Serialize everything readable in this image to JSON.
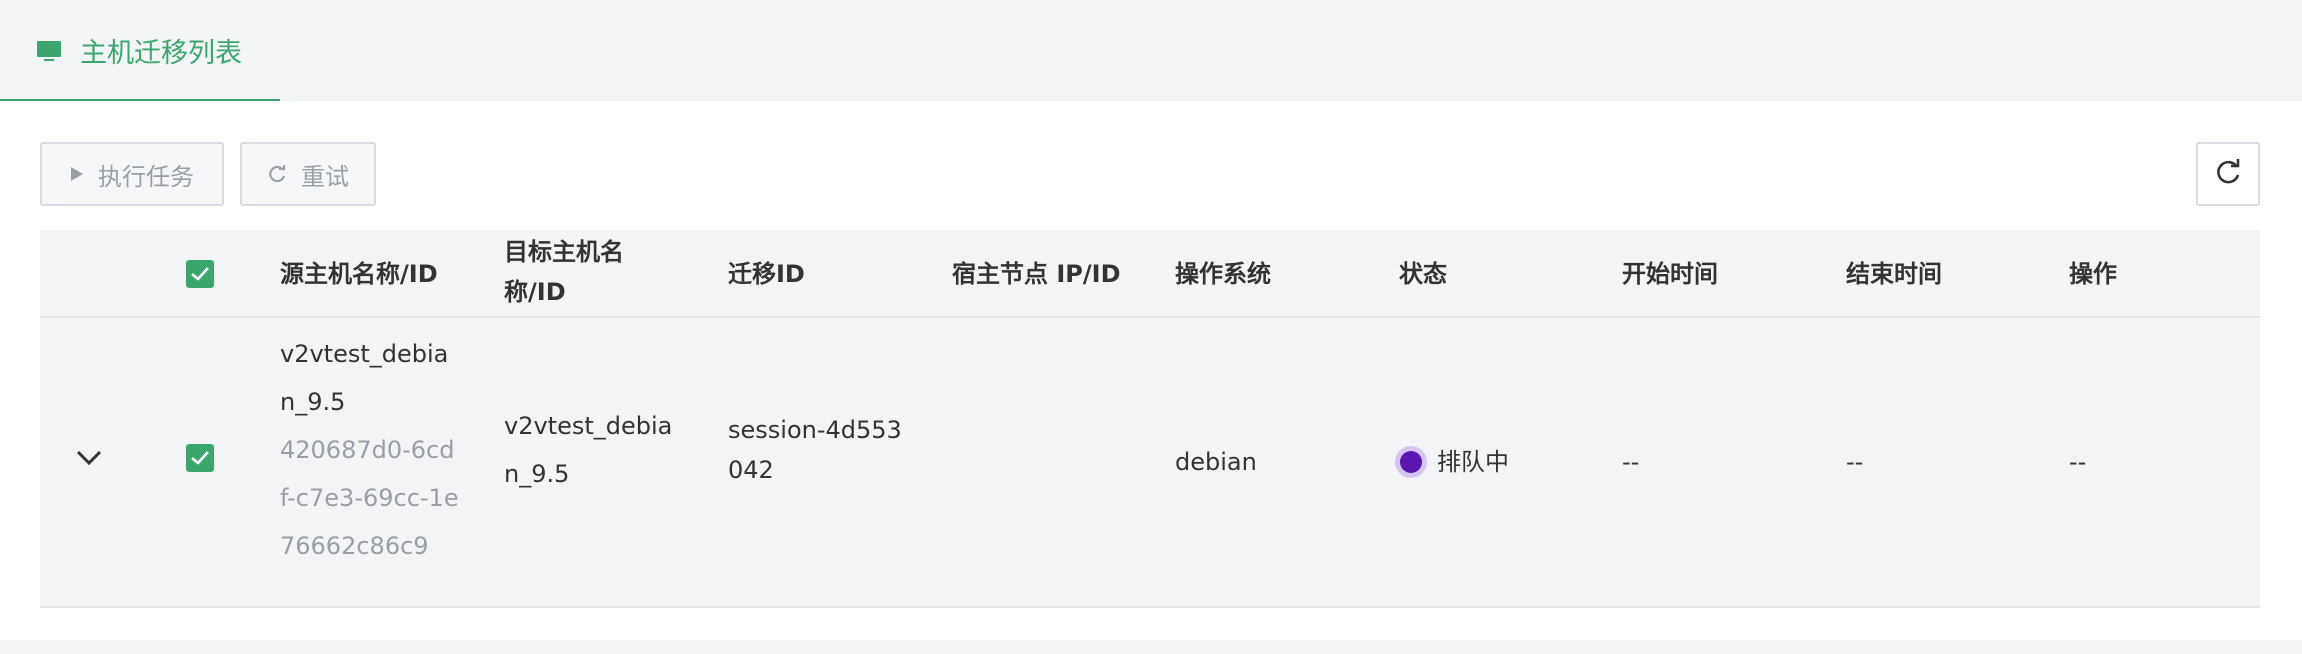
{
  "tab": {
    "title": "主机迁移列表",
    "icon": "monitor-icon"
  },
  "toolbar": {
    "exec_label": "执行任务",
    "retry_label": "重试",
    "refresh_icon": "refresh-icon"
  },
  "colors": {
    "accent": "#3aa66e",
    "status_queued": "#5a16b0"
  },
  "table": {
    "headers": {
      "source": "源主机名称/ID",
      "target_line1": "目标主机名",
      "target_line2": "称/ID",
      "migration_id": "迁移ID",
      "host_node": "宿主节点 IP/ID",
      "os": "操作系统",
      "status": "状态",
      "start_time": "开始时间",
      "end_time": "结束时间",
      "actions": "操作"
    },
    "rows": [
      {
        "source_name_line1": "v2vtest_debia",
        "source_name_line2": "n_9.5",
        "source_id_line1": "420687d0-6cd",
        "source_id_line2": "f-c7e3-69cc-1e",
        "source_id_line3": "76662c86c9",
        "target_line1": "v2vtest_debia",
        "target_line2": "n_9.5",
        "migration_line1": "session-4d553",
        "migration_line2": "042",
        "host_node": "",
        "os": "debian",
        "status": "排队中",
        "start_time": "--",
        "end_time": "--",
        "actions": "--"
      }
    ]
  }
}
